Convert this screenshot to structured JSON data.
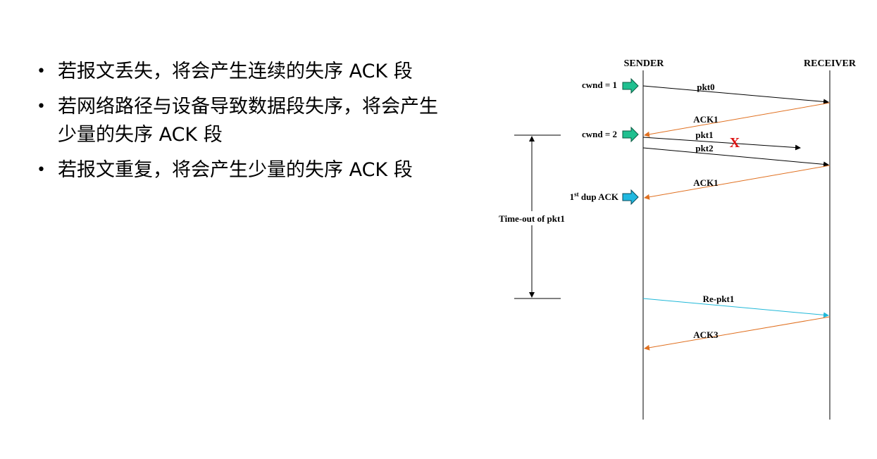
{
  "bullets": [
    {
      "marker": "•",
      "text": "若报文丢失，将会产生连续的失序 ACK 段"
    },
    {
      "marker": "•",
      "text": "若网络路径与设备导致数据段失序，将会产生少量的失序 ACK 段"
    },
    {
      "marker": "•",
      "text": "若报文重复，将会产生少量的失序 ACK 段"
    }
  ],
  "diagram": {
    "sender_label": "SENDER",
    "receiver_label": "RECEIVER",
    "cwnd1": "cwnd = 1",
    "cwnd2": "cwnd = 2",
    "pkt0": "pkt0",
    "ack1_first": "ACK1",
    "pkt1": "pkt1",
    "pkt2": "pkt2",
    "loss_mark": "X",
    "ack1_second": "ACK1",
    "dup_ack_prefix": "1",
    "dup_ack_sup": "st",
    "dup_ack_suffix": " dup ACK",
    "timeout_label": "Time-out of pkt1",
    "repkt1": "Re-pkt1",
    "ack3": "ACK3",
    "colors": {
      "ack": "#e07020",
      "retransmit": "#20b8d8",
      "cwnd_arrow": "#20c090",
      "dup_arrow": "#20b8e0",
      "loss": "#dd1111"
    }
  }
}
